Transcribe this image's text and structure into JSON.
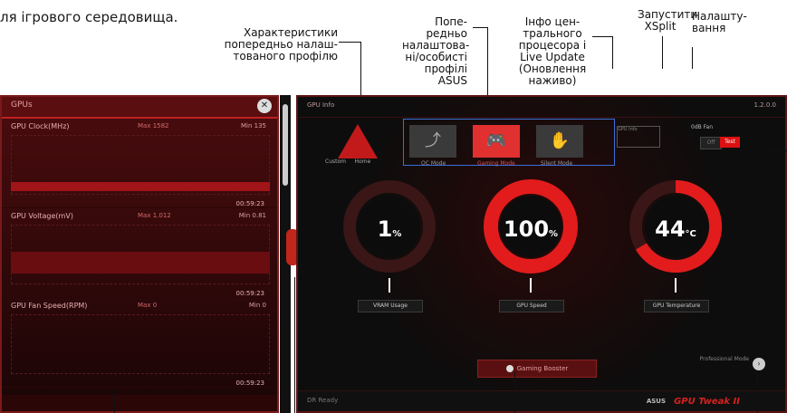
{
  "doc": {
    "line1": "",
    "line2": "ля ігрового середовища."
  },
  "callouts": {
    "profile_chars": "Характеристики попередньо налаш-тованого профілю",
    "preset": "Попе-редньо налаштова-ні/особисті профілі ASUS",
    "cpu_info": "Інфо цен-трального процесора і Live Update (Оновлення наживо)",
    "xsplit": "Запустити XSplit",
    "settings": "Налашту-вання"
  },
  "left_panel": {
    "title": "GPUs",
    "graphs": [
      {
        "title": "GPU Clock(MHz)",
        "value": "Max 1582",
        "max": "Min 135",
        "time": "00:59:23"
      },
      {
        "title": "GPU Voltage(mV)",
        "value": "Max 1.012",
        "max": "Min 0.81",
        "time": "00:59:23"
      },
      {
        "title": "GPU Fan Speed(RPM)",
        "value": "Max 0",
        "max": "Min 0",
        "time": "00:59:23"
      }
    ]
  },
  "main": {
    "top_left": "GPU Info",
    "top_right": "1.2.0.0",
    "logo_left": "Custom",
    "logo_right": "Home",
    "modes": [
      {
        "label": "OC Mode",
        "icon": "⤴"
      },
      {
        "label": "Gaming Mode",
        "icon": "🎮"
      },
      {
        "label": "Silent Mode",
        "icon": "✋"
      }
    ],
    "info_box": "GPU Info",
    "oc_title": "0dB Fan",
    "oc_off": "Off",
    "oc_on": "Test",
    "gauges": [
      {
        "value": "1",
        "unit": "%",
        "label": "VRAM Usage"
      },
      {
        "value": "100",
        "unit": "%",
        "label": "GPU Speed"
      },
      {
        "value": "44",
        "unit": "°C",
        "label": "GPU Temperature"
      }
    ],
    "boost_label": "Gaming Booster",
    "settings_label": "Professional Mode",
    "bottom_left": "DR Ready",
    "asus": "ASUS",
    "brand": "GPU Tweak II"
  }
}
